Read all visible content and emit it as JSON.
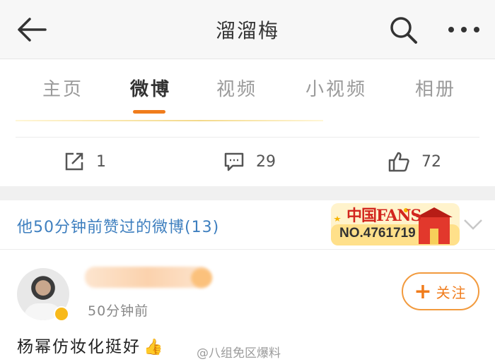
{
  "nav": {
    "title": "溜溜梅"
  },
  "tabs": [
    "主页",
    "微博",
    "视频",
    "小视频",
    "相册"
  ],
  "active_tab": "微博",
  "post_actions": {
    "repost": "1",
    "comment": "29",
    "like": "72"
  },
  "liked_section": {
    "text": "他50分钟前赞过的微博(13)",
    "badge": {
      "brand": "中国FANS",
      "number": "NO.4761719"
    }
  },
  "post": {
    "time": "50分钟前",
    "follow_label": "关注",
    "content": "杨幂仿妆化挺好",
    "emoji": "👍",
    "watermark": "@八组免区爆料"
  },
  "colors": {
    "accent": "#f07c1c",
    "link": "#3e7fbf",
    "verify": "#f8b91a"
  }
}
